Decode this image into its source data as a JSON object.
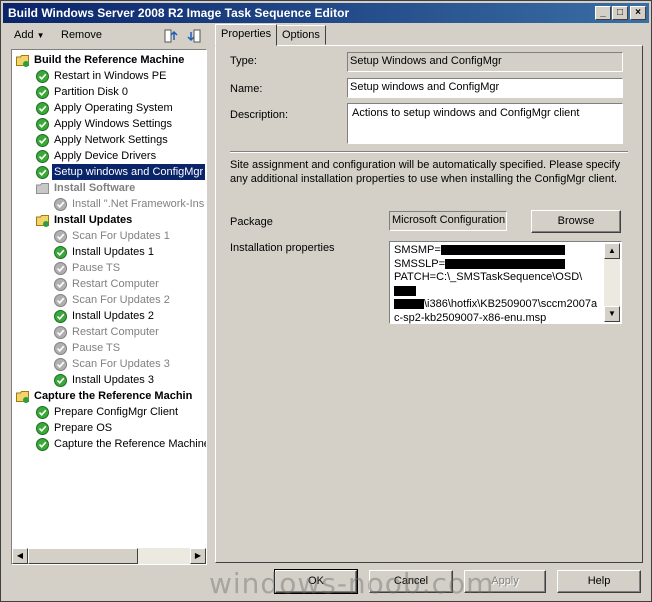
{
  "window": {
    "title": "Build Windows Server 2008 R2 Image Task Sequence Editor"
  },
  "toolbar": {
    "add_label": "Add",
    "remove_label": "Remove"
  },
  "tree": {
    "items": [
      {
        "label": "Build the Reference Machine",
        "type": "group",
        "state": "ok"
      },
      {
        "label": "Restart in Windows PE",
        "type": "step",
        "state": "ok"
      },
      {
        "label": "Partition Disk 0",
        "type": "step",
        "state": "ok"
      },
      {
        "label": "Apply Operating System",
        "type": "step",
        "state": "ok"
      },
      {
        "label": "Apply Windows Settings",
        "type": "step",
        "state": "ok"
      },
      {
        "label": "Apply Network Settings",
        "type": "step",
        "state": "ok"
      },
      {
        "label": "Apply Device Drivers",
        "type": "step",
        "state": "ok"
      },
      {
        "label": "Setup windows and ConfigMgr",
        "type": "step",
        "state": "ok",
        "selected": true
      },
      {
        "label": "Install Software",
        "type": "group",
        "state": "disabled"
      },
      {
        "label": "Install \".Net Framework-Ins",
        "type": "step",
        "state": "disabled"
      },
      {
        "label": "Install Updates",
        "type": "group",
        "state": "ok"
      },
      {
        "label": "Scan For Updates 1",
        "type": "step",
        "state": "disabled"
      },
      {
        "label": "Install Updates 1",
        "type": "step",
        "state": "ok"
      },
      {
        "label": "Pause TS",
        "type": "step",
        "state": "disabled"
      },
      {
        "label": "Restart Computer",
        "type": "step",
        "state": "disabled"
      },
      {
        "label": "Scan For Updates 2",
        "type": "step",
        "state": "disabled"
      },
      {
        "label": "Install Updates 2",
        "type": "step",
        "state": "ok"
      },
      {
        "label": "Restart Computer",
        "type": "step",
        "state": "disabled"
      },
      {
        "label": "Pause TS",
        "type": "step",
        "state": "disabled"
      },
      {
        "label": "Scan For Updates 3",
        "type": "step",
        "state": "disabled"
      },
      {
        "label": "Install Updates 3",
        "type": "step",
        "state": "ok"
      },
      {
        "label": "Capture the Reference Machin",
        "type": "group",
        "state": "ok"
      },
      {
        "label": "Prepare ConfigMgr Client",
        "type": "step",
        "state": "ok"
      },
      {
        "label": "Prepare OS",
        "type": "step",
        "state": "ok"
      },
      {
        "label": "Capture the Reference Machine",
        "type": "step",
        "state": "ok"
      }
    ]
  },
  "tabs": [
    {
      "label": "Properties"
    },
    {
      "label": "Options"
    }
  ],
  "properties": {
    "type_label": "Type:",
    "type_value": "Setup Windows and ConfigMgr",
    "name_label": "Name:",
    "name_value": "Setup windows and ConfigMgr",
    "description_label": "Description:",
    "description_value": "Actions to setup windows and ConfigMgr client",
    "info_text": "Site assignment and configuration will be automatically specified. Please specify any additional installation properties to use when installing the ConfigMgr client.",
    "package_label": "Package",
    "package_value": "Microsoft Configuration",
    "browse_label": "Browse",
    "install_props_label": "Installation properties",
    "install_props_line1": "SMSMP=",
    "install_props_line2": "SMSSLP=",
    "install_props_line3": "PATCH=C:\\_SMSTaskSequence\\OSD\\",
    "install_props_line4": "\\i386\\hotfix\\KB2509007\\sccm2007a",
    "install_props_line5": "c-sp2-kb2509007-x86-enu.msp"
  },
  "buttons": {
    "ok": "OK",
    "cancel": "Cancel",
    "apply": "Apply",
    "help": "Help"
  },
  "watermark": "windows-noob.com"
}
